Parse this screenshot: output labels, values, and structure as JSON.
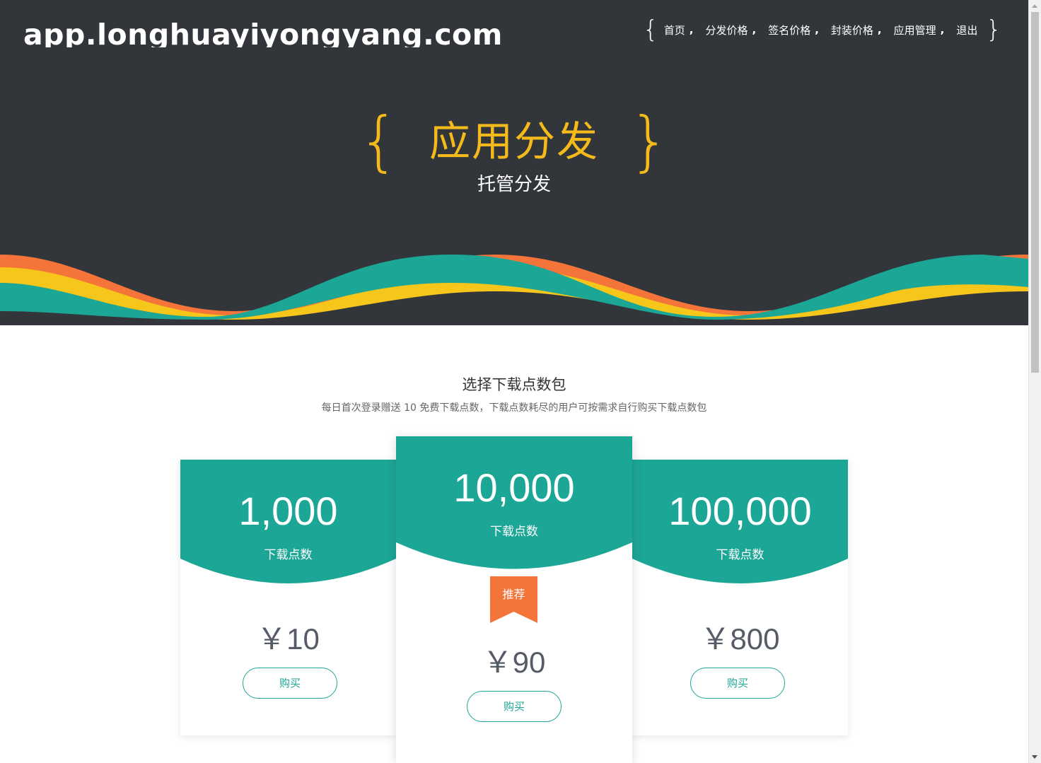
{
  "brand": "app.longhuayiyongyang.com",
  "nav": {
    "items": [
      "首页",
      "分发价格",
      "签名价格",
      "封装价格",
      "应用管理",
      "退出"
    ],
    "separator": ","
  },
  "hero": {
    "brace_left": "{",
    "brace_right": "}",
    "title": "应用分发",
    "subtitle": "托管分发"
  },
  "section": {
    "title": "选择下载点数包",
    "subtitle": "每日首次登录赠送 10 免费下载点数，下载点数耗尽的用户可按需求自行购买下载点数包"
  },
  "plans": [
    {
      "points": "1,000",
      "unit": "下载点数",
      "price": "￥10",
      "button": "购买"
    },
    {
      "points": "10,000",
      "unit": "下载点数",
      "price": "￥90",
      "button": "购买",
      "badge": "推荐"
    },
    {
      "points": "100,000",
      "unit": "下载点数",
      "price": "￥800",
      "button": "购买"
    }
  ],
  "colors": {
    "header_bg": "#32363a",
    "accent_yellow": "#f4b91b",
    "teal": "#1ca696",
    "orange": "#f5743a"
  }
}
